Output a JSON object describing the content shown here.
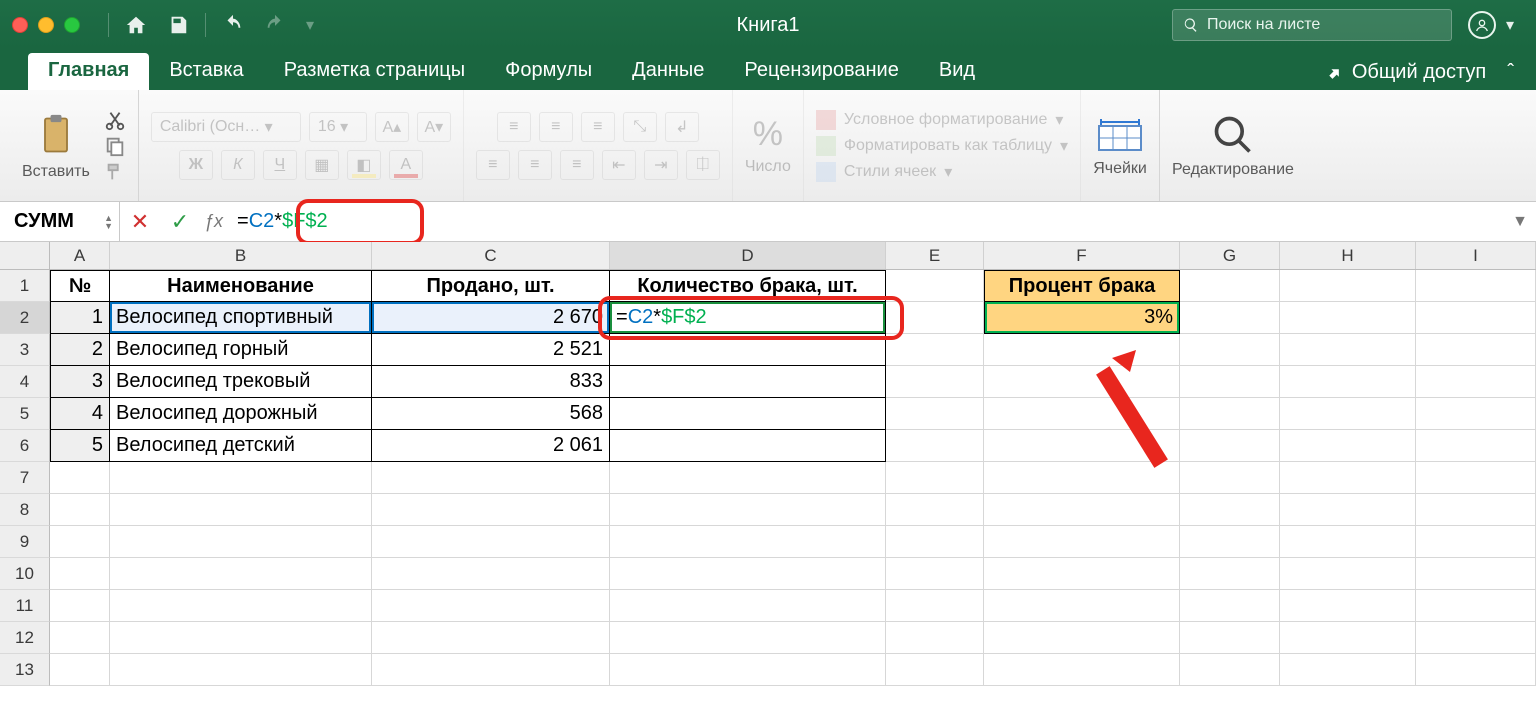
{
  "title": "Книга1",
  "search_placeholder": "Поиск на листе",
  "tabs": {
    "t0": "Главная",
    "t1": "Вставка",
    "t2": "Разметка страницы",
    "t3": "Формулы",
    "t4": "Данные",
    "t5": "Рецензирование",
    "t6": "Вид",
    "share": "Общий доступ"
  },
  "ribbon": {
    "paste": "Вставить",
    "font_name": "Calibri (Осн…",
    "font_size": "16",
    "number": "Число",
    "cond_fmt": "Условное форматирование",
    "as_table": "Форматировать как таблицу",
    "cell_styles": "Стили ячеек",
    "cells": "Ячейки",
    "editing": "Редактирование"
  },
  "formula_bar": {
    "name_box": "СУММ",
    "formula_raw": "=C2*$F$2",
    "f_eq": "=",
    "f_c2": "C2",
    "f_star": "*",
    "f_f2": "$F$2"
  },
  "columns": {
    "A": "A",
    "B": "B",
    "C": "C",
    "D": "D",
    "E": "E",
    "F": "F",
    "G": "G",
    "H": "H",
    "I": "I"
  },
  "row_numbers": {
    "r1": "1",
    "r2": "2",
    "r3": "3",
    "r4": "4",
    "r5": "5",
    "r6": "6",
    "r7": "7",
    "r8": "8",
    "r9": "9",
    "r10": "10",
    "r11": "11",
    "r12": "12",
    "r13": "13"
  },
  "table": {
    "h_no": "№",
    "h_name": "Наименование",
    "h_sold": "Продано, шт.",
    "h_defect_qty": "Количество брака, шт.",
    "h_defect_pct": "Процент брака",
    "r1": {
      "no": "1",
      "name": "Велосипед спортивный",
      "sold": "2 670"
    },
    "r2": {
      "no": "2",
      "name": "Велосипед горный",
      "sold": "2 521"
    },
    "r3": {
      "no": "3",
      "name": "Велосипед трековый",
      "sold": "833"
    },
    "r4": {
      "no": "4",
      "name": "Велосипед дорожный",
      "sold": "568"
    },
    "r5": {
      "no": "5",
      "name": "Велосипед детский",
      "sold": "2 061"
    },
    "pct": "3%"
  },
  "cell_formula": {
    "eq": "=",
    "c2": "C2",
    "star": "*",
    "f2": "$F$2"
  }
}
